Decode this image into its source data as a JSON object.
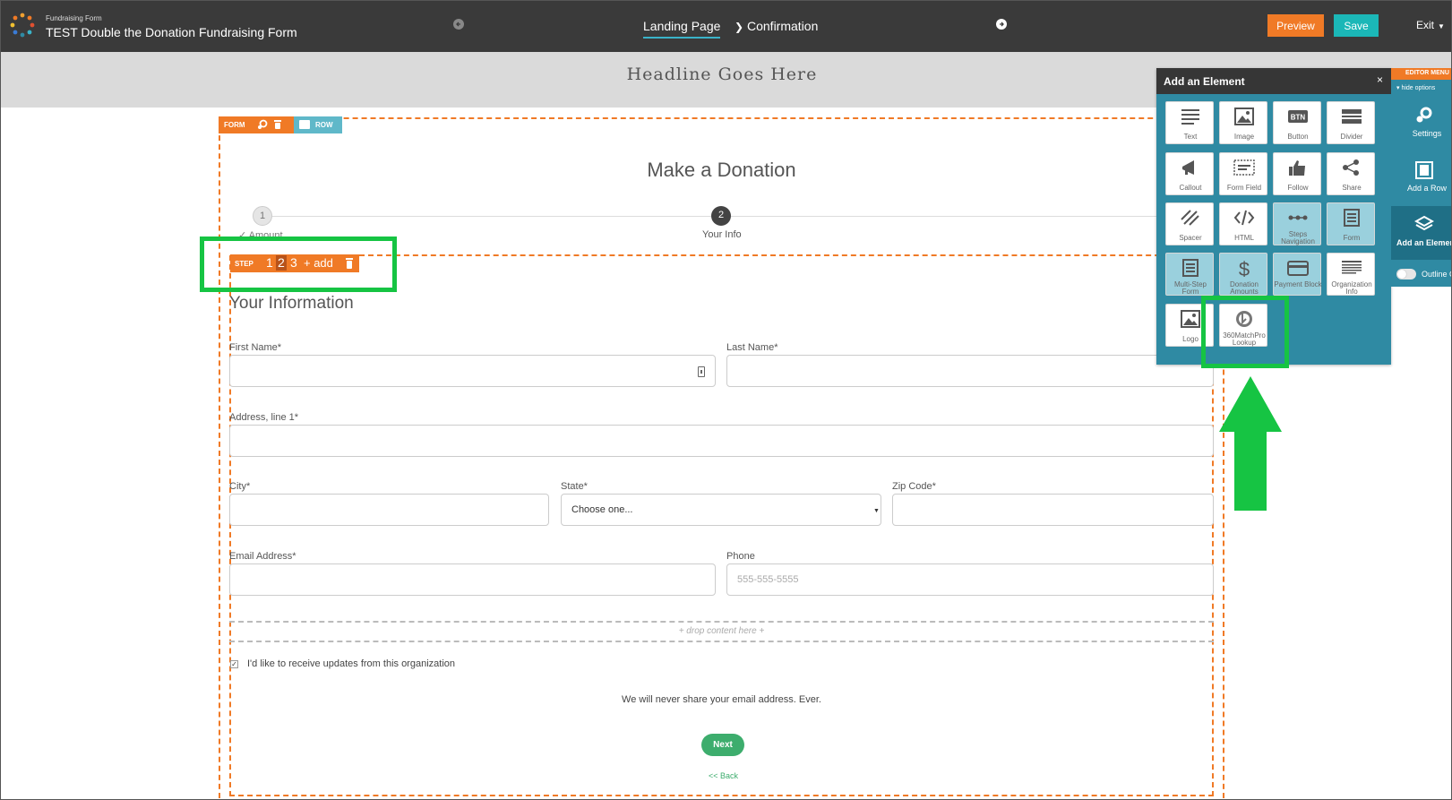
{
  "topbar": {
    "app_subtitle": "Fundraising Form",
    "app_title": "TEST Double the Donation Fundraising Form",
    "tabs": [
      "Landing Page",
      "Confirmation"
    ],
    "tab_separator": "❯",
    "preview_label": "Preview",
    "save_label": "Save",
    "exit_label": "Exit",
    "exit_caret": "▼"
  },
  "headline": "Headline Goes Here",
  "form": {
    "form_tag": "FORM",
    "row_tag": "ROW",
    "title": "Make a Donation",
    "steps": [
      {
        "number": "1",
        "label": "✓ Amount"
      },
      {
        "number": "2",
        "label": "Your Info"
      }
    ],
    "step_toolbar": {
      "label": "STEP",
      "numbers": [
        "1",
        "2",
        "3"
      ],
      "add_label": "+ add"
    },
    "section_title": "Your Information",
    "fields": {
      "first_name": "First Name*",
      "last_name": "Last Name*",
      "address": "Address, line 1*",
      "city": "City*",
      "state": "State*",
      "state_value": "Choose one...",
      "zip": "Zip Code*",
      "email": "Email Address*",
      "phone": "Phone",
      "phone_placeholder": "555-555-5555"
    },
    "drop_zone": "+ drop content here +",
    "updates_label": "I'd like to receive updates from this organization",
    "updates_checked": true,
    "privacy_text": "We will never share your email address.  Ever.",
    "next_label": "Next",
    "back_label": "<< Back"
  },
  "panel": {
    "title": "Add an Element",
    "close": "×",
    "tiles": [
      {
        "label": "Text",
        "icon": "text-icon",
        "dim": false
      },
      {
        "label": "Image",
        "icon": "image-icon",
        "dim": false
      },
      {
        "label": "Button",
        "icon": "button-icon",
        "dim": false
      },
      {
        "label": "Divider",
        "icon": "divider-icon",
        "dim": false
      },
      {
        "label": "Callout",
        "icon": "megaphone-icon",
        "dim": false
      },
      {
        "label": "Form Field",
        "icon": "form-field-icon",
        "dim": false
      },
      {
        "label": "Follow",
        "icon": "thumbs-up-icon",
        "dim": false
      },
      {
        "label": "Share",
        "icon": "share-icon",
        "dim": false
      },
      {
        "label": "Spacer",
        "icon": "spacer-icon",
        "dim": false
      },
      {
        "label": "HTML",
        "icon": "code-icon",
        "dim": false
      },
      {
        "label": "Steps Navigation",
        "icon": "steps-icon",
        "dim": true
      },
      {
        "label": "Form",
        "icon": "form-icon",
        "dim": true
      },
      {
        "label": "Multi-Step Form",
        "icon": "multistep-icon",
        "dim": true
      },
      {
        "label": "Donation Amounts",
        "icon": "dollar-icon",
        "dim": true
      },
      {
        "label": "Payment Block",
        "icon": "card-icon",
        "dim": true
      },
      {
        "label": "Organization Info",
        "icon": "org-info-icon",
        "dim": false
      },
      {
        "label": "Logo",
        "icon": "logo-icon",
        "dim": false
      },
      {
        "label": "360MatchPro Lookup",
        "icon": "matchpro-icon",
        "dim": false
      }
    ],
    "button_icon_text": "BTN"
  },
  "editor_menu": {
    "title": "EDITOR MENU",
    "hide_options": "▾ hide options",
    "items": [
      "Settings",
      "Add a Row",
      "Add an Element"
    ],
    "outline_label": "Outline Off"
  },
  "colors": {
    "accent_orange": "#f07a26",
    "accent_teal": "#1bb7b7",
    "panel_blue": "#2f8aa3",
    "highlight_green": "#16c443",
    "next_green": "#3dad6d"
  }
}
